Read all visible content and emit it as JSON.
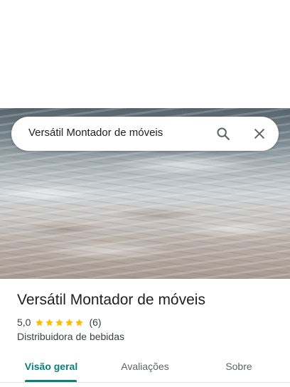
{
  "search": {
    "query": "Versátil Montador de móveis"
  },
  "place": {
    "title": "Versátil Montador de móveis",
    "rating": "5,0",
    "stars": 5,
    "review_count": "(6)",
    "category": "Distribuidora de bebidas"
  },
  "tabs": [
    {
      "label": "Visão geral",
      "selected": true
    },
    {
      "label": "Avaliações",
      "selected": false
    },
    {
      "label": "Sobre",
      "selected": false
    }
  ],
  "colors": {
    "accent": "#0b7f7a",
    "star": "#fbbc04",
    "text_primary": "#202124",
    "text_secondary": "#3c4043"
  },
  "icons": {
    "search": "search-icon",
    "close": "close-icon",
    "star": "star-icon"
  }
}
